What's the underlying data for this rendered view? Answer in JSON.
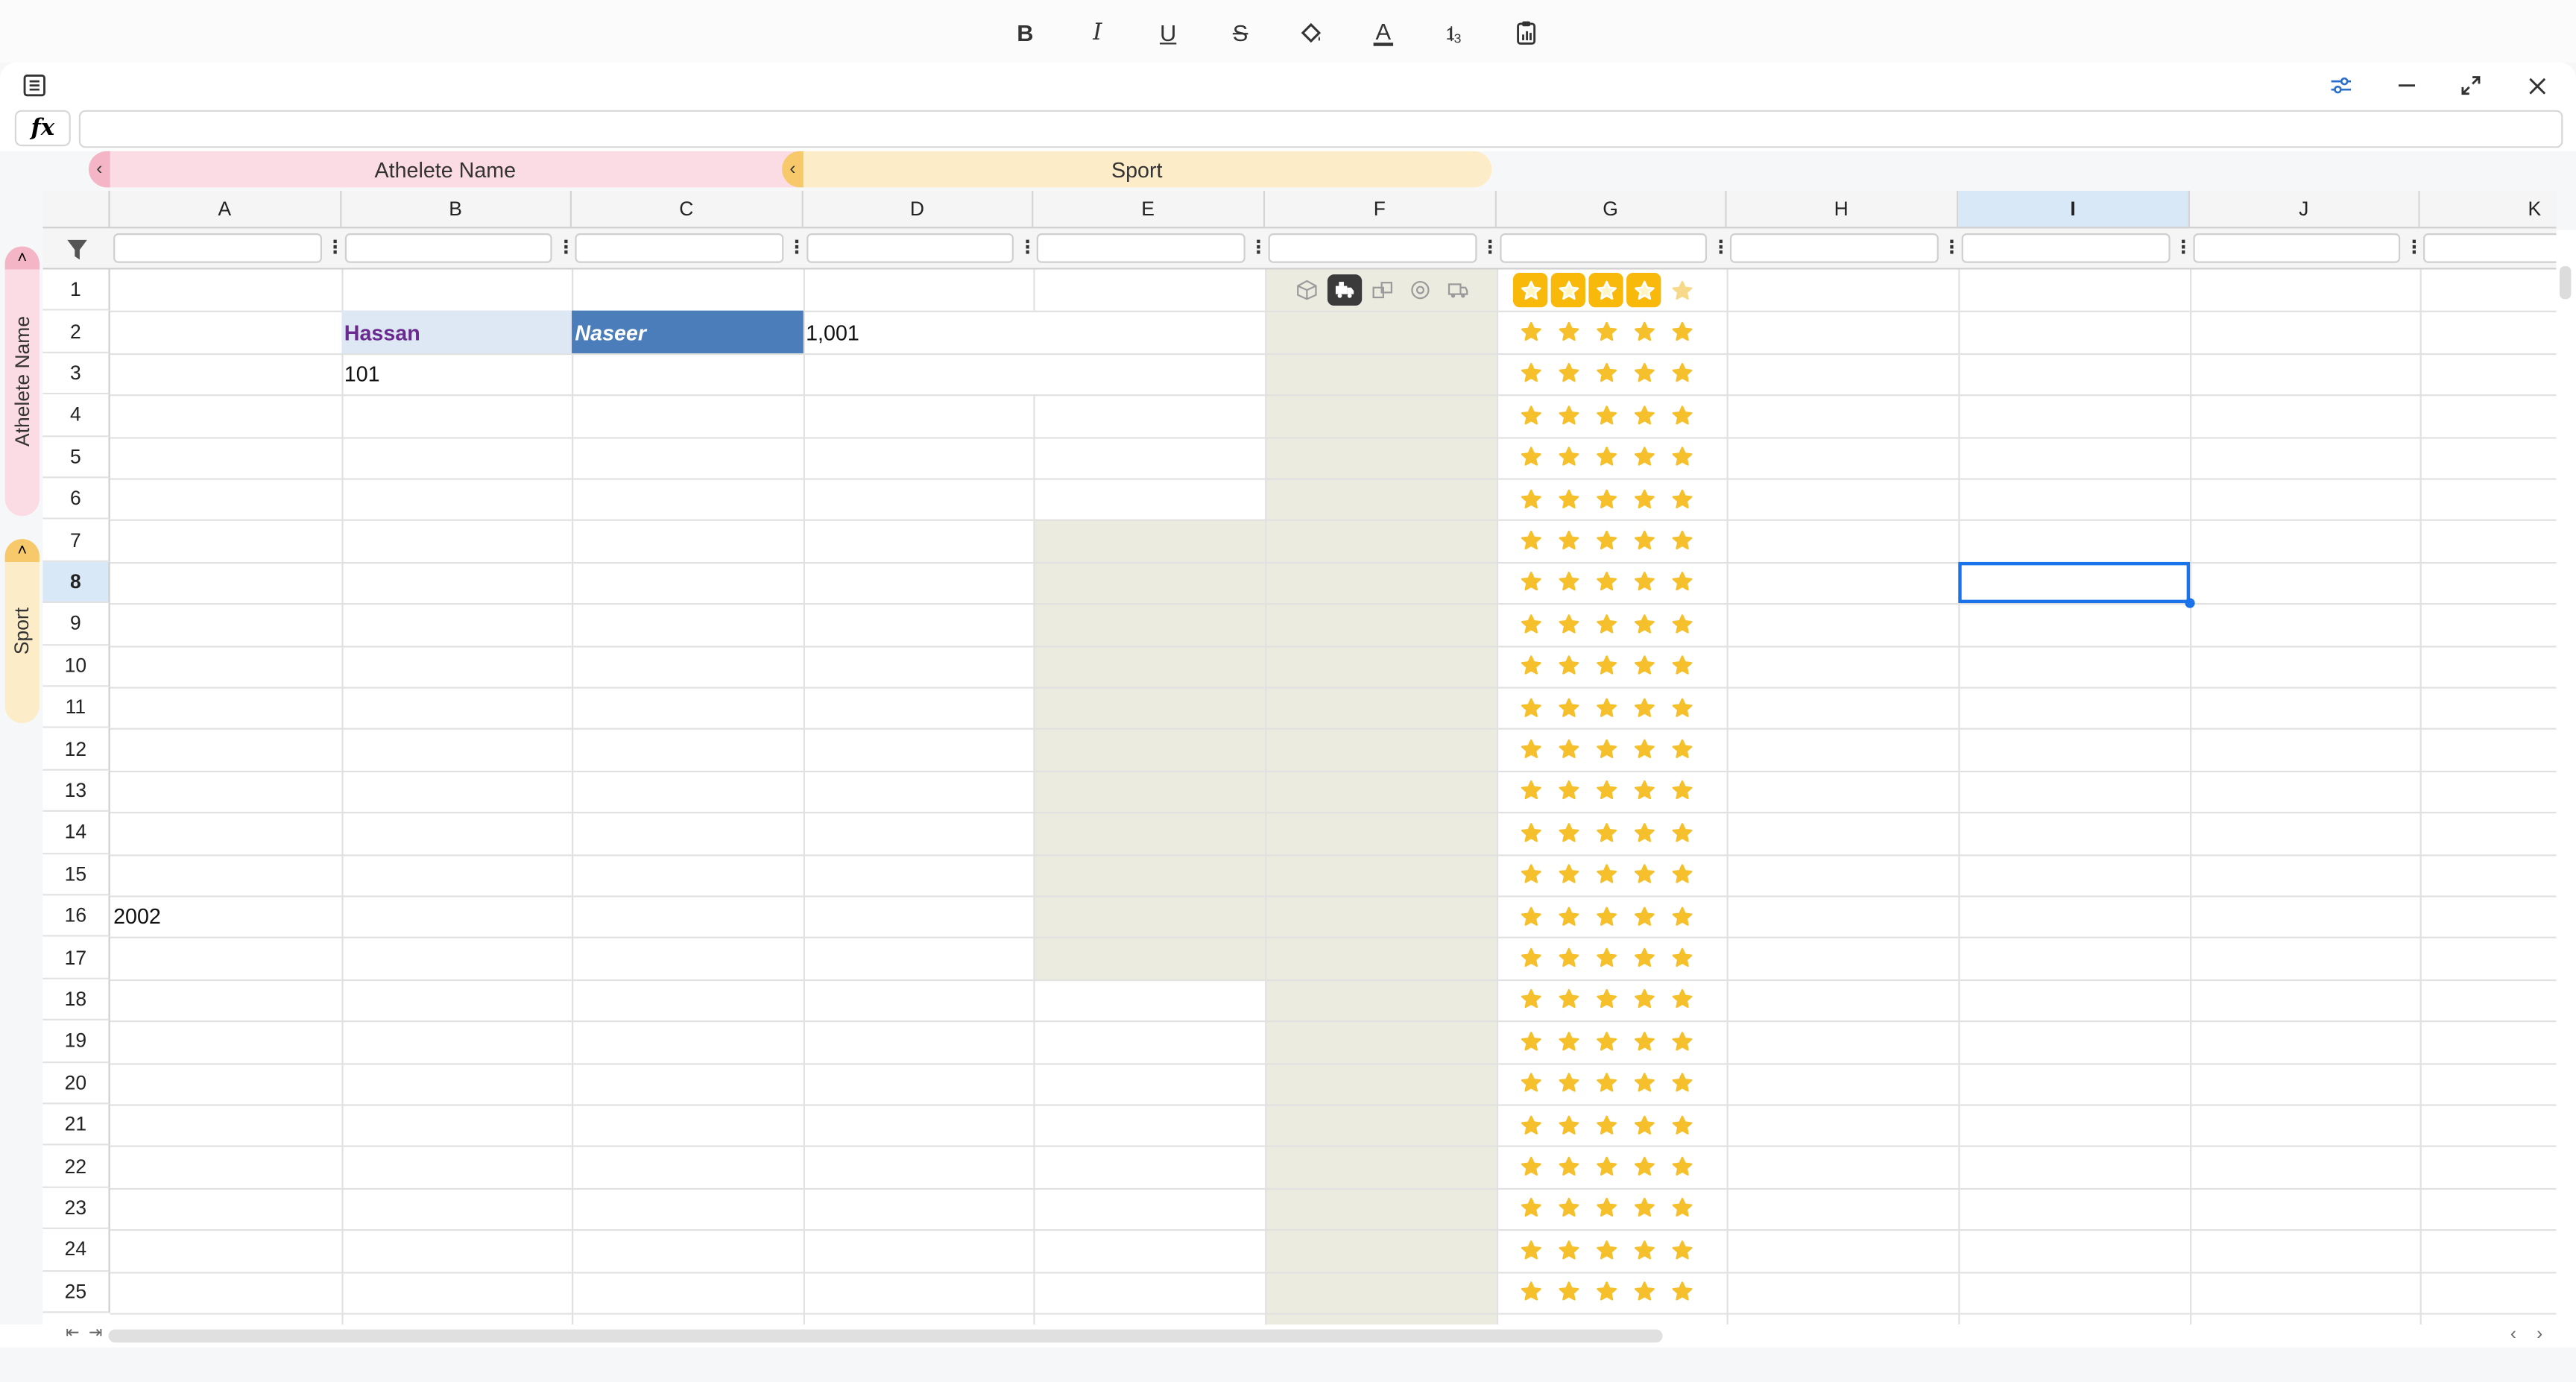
{
  "toolbar": {
    "bold": "B",
    "italic": "I",
    "underline": "U",
    "strikethrough": "S",
    "font_color": "A"
  },
  "formula_bar": {
    "fx_label": "fx",
    "value": ""
  },
  "groups": {
    "athlete_name": "Athelete Name",
    "sport": "Sport"
  },
  "columns": [
    "A",
    "B",
    "C",
    "D",
    "E",
    "F",
    "G",
    "H",
    "I",
    "J",
    "K"
  ],
  "selected_column": "I",
  "rows": [
    "1",
    "2",
    "3",
    "4",
    "5",
    "6",
    "7",
    "8",
    "9",
    "10",
    "11",
    "12",
    "13",
    "14",
    "15",
    "16",
    "17",
    "18",
    "19",
    "20",
    "21",
    "22",
    "23",
    "24",
    "25"
  ],
  "selected_row": "8",
  "cells": {
    "B2": "Hassan",
    "C2": "Naseer",
    "D2": "1,001",
    "B3": "101",
    "A16": "2002"
  },
  "rating_row1": {
    "value": 4,
    "max": 5
  },
  "ratings_default": {
    "value": 5,
    "max": 5
  },
  "colors": {
    "pink_band": "#fbdce4",
    "pink_chevron": "#f4b6c7",
    "orange_band": "#fdecc8",
    "orange_chevron": "#f7c96b",
    "hassan_fill": "#dde8f4",
    "hassan_text": "#6a2a8f",
    "naseer_fill": "#4a7dba",
    "selection": "#1a73e8",
    "star": "#f5c02b",
    "shade": "#ecebe0"
  },
  "icons": {
    "toolbar": [
      "bold-icon",
      "italic-icon",
      "underline-icon",
      "strikethrough-icon",
      "fill-color-icon",
      "font-color-icon",
      "number-format-icon",
      "clipboard-chart-icon"
    ],
    "window": [
      "sheet-list-icon",
      "settings-sliders-icon",
      "minimize-icon",
      "expand-icon",
      "close-icon"
    ],
    "f1_status": [
      "box-icon",
      "delivery-truck-active-icon",
      "shipping-boxes-icon",
      "cancelled-circle-icon",
      "returned-truck-icon"
    ]
  }
}
